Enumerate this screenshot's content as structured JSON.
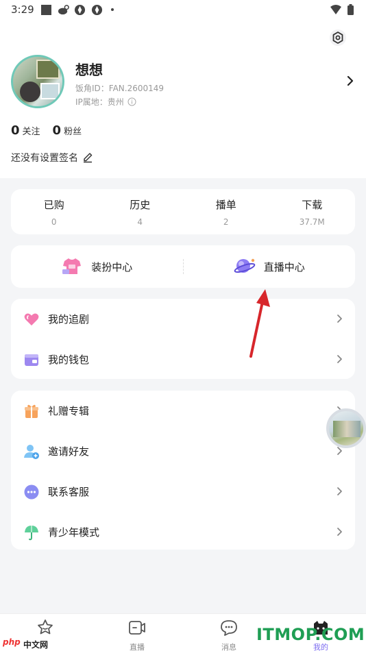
{
  "status_bar": {
    "time": "3:29"
  },
  "profile": {
    "nickname": "想想",
    "id_text": "饭角ID：FAN.2600149",
    "ip_text": "IP属地：贵州",
    "following_count": "0",
    "following_label": "关注",
    "fans_count": "0",
    "fans_label": "粉丝",
    "signature": "还没有设置签名"
  },
  "quick_stats": [
    {
      "label": "已购",
      "value": "0"
    },
    {
      "label": "历史",
      "value": "4"
    },
    {
      "label": "播单",
      "value": "2"
    },
    {
      "label": "下载",
      "value": "37.7M"
    }
  ],
  "centers": {
    "dress_up": "装扮中心",
    "live": "直播中心"
  },
  "menu_group1": [
    "我的追剧",
    "我的钱包"
  ],
  "menu_group2": [
    "礼赠专辑",
    "邀请好友",
    "联系客服",
    "青少年模式"
  ],
  "bottom_nav": {
    "home": "",
    "live": "直播",
    "messages": "消息",
    "me": "我的"
  },
  "watermarks": {
    "php": "php",
    "cn": "中文网",
    "itmop": "ITMOP.COM"
  },
  "colors": {
    "accent_purple": "#7c6cf0",
    "arrow_red": "#d7262b",
    "watermark_green": "#1f9e54"
  }
}
